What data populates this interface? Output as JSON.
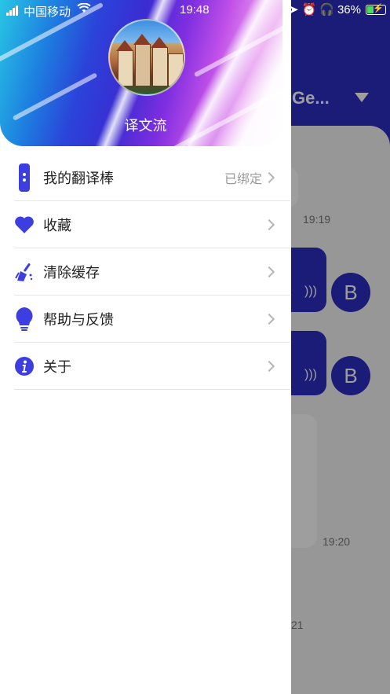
{
  "status_bar": {
    "carrier": "中国移动",
    "time": "19:48",
    "battery_percent": "36%"
  },
  "background_app": {
    "title": "Ge...",
    "timestamps": [
      "19:19",
      "19:20",
      "21"
    ],
    "avatar_letter": "B"
  },
  "drawer": {
    "username": "译文流",
    "menu": [
      {
        "label": "我的翻译棒",
        "value": "已绑定",
        "icon": "translator-device-icon"
      },
      {
        "label": "收藏",
        "value": "",
        "icon": "heart-icon"
      },
      {
        "label": "清除缓存",
        "value": "",
        "icon": "broom-icon"
      },
      {
        "label": "帮助与反馈",
        "value": "",
        "icon": "lightbulb-icon"
      },
      {
        "label": "关于",
        "value": "",
        "icon": "info-icon"
      }
    ]
  },
  "colors": {
    "accent": "#2d2ec2",
    "icon": "#3d3ee0",
    "overlay": "rgba(0,0,0,0.38)"
  }
}
